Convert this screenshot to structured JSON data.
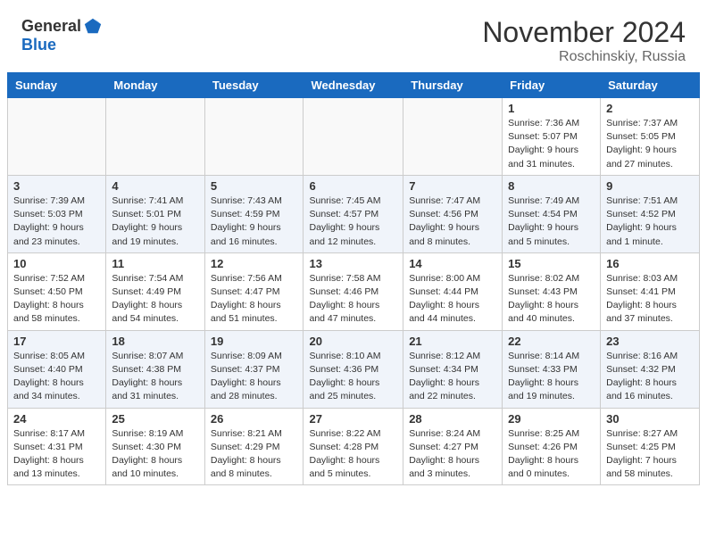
{
  "header": {
    "logo_general": "General",
    "logo_blue": "Blue",
    "month_title": "November 2024",
    "location": "Roschinskiy, Russia"
  },
  "days_of_week": [
    "Sunday",
    "Monday",
    "Tuesday",
    "Wednesday",
    "Thursday",
    "Friday",
    "Saturday"
  ],
  "weeks": [
    [
      {
        "day": "",
        "info": ""
      },
      {
        "day": "",
        "info": ""
      },
      {
        "day": "",
        "info": ""
      },
      {
        "day": "",
        "info": ""
      },
      {
        "day": "",
        "info": ""
      },
      {
        "day": "1",
        "info": "Sunrise: 7:36 AM\nSunset: 5:07 PM\nDaylight: 9 hours and 31 minutes."
      },
      {
        "day": "2",
        "info": "Sunrise: 7:37 AM\nSunset: 5:05 PM\nDaylight: 9 hours and 27 minutes."
      }
    ],
    [
      {
        "day": "3",
        "info": "Sunrise: 7:39 AM\nSunset: 5:03 PM\nDaylight: 9 hours and 23 minutes."
      },
      {
        "day": "4",
        "info": "Sunrise: 7:41 AM\nSunset: 5:01 PM\nDaylight: 9 hours and 19 minutes."
      },
      {
        "day": "5",
        "info": "Sunrise: 7:43 AM\nSunset: 4:59 PM\nDaylight: 9 hours and 16 minutes."
      },
      {
        "day": "6",
        "info": "Sunrise: 7:45 AM\nSunset: 4:57 PM\nDaylight: 9 hours and 12 minutes."
      },
      {
        "day": "7",
        "info": "Sunrise: 7:47 AM\nSunset: 4:56 PM\nDaylight: 9 hours and 8 minutes."
      },
      {
        "day": "8",
        "info": "Sunrise: 7:49 AM\nSunset: 4:54 PM\nDaylight: 9 hours and 5 minutes."
      },
      {
        "day": "9",
        "info": "Sunrise: 7:51 AM\nSunset: 4:52 PM\nDaylight: 9 hours and 1 minute."
      }
    ],
    [
      {
        "day": "10",
        "info": "Sunrise: 7:52 AM\nSunset: 4:50 PM\nDaylight: 8 hours and 58 minutes."
      },
      {
        "day": "11",
        "info": "Sunrise: 7:54 AM\nSunset: 4:49 PM\nDaylight: 8 hours and 54 minutes."
      },
      {
        "day": "12",
        "info": "Sunrise: 7:56 AM\nSunset: 4:47 PM\nDaylight: 8 hours and 51 minutes."
      },
      {
        "day": "13",
        "info": "Sunrise: 7:58 AM\nSunset: 4:46 PM\nDaylight: 8 hours and 47 minutes."
      },
      {
        "day": "14",
        "info": "Sunrise: 8:00 AM\nSunset: 4:44 PM\nDaylight: 8 hours and 44 minutes."
      },
      {
        "day": "15",
        "info": "Sunrise: 8:02 AM\nSunset: 4:43 PM\nDaylight: 8 hours and 40 minutes."
      },
      {
        "day": "16",
        "info": "Sunrise: 8:03 AM\nSunset: 4:41 PM\nDaylight: 8 hours and 37 minutes."
      }
    ],
    [
      {
        "day": "17",
        "info": "Sunrise: 8:05 AM\nSunset: 4:40 PM\nDaylight: 8 hours and 34 minutes."
      },
      {
        "day": "18",
        "info": "Sunrise: 8:07 AM\nSunset: 4:38 PM\nDaylight: 8 hours and 31 minutes."
      },
      {
        "day": "19",
        "info": "Sunrise: 8:09 AM\nSunset: 4:37 PM\nDaylight: 8 hours and 28 minutes."
      },
      {
        "day": "20",
        "info": "Sunrise: 8:10 AM\nSunset: 4:36 PM\nDaylight: 8 hours and 25 minutes."
      },
      {
        "day": "21",
        "info": "Sunrise: 8:12 AM\nSunset: 4:34 PM\nDaylight: 8 hours and 22 minutes."
      },
      {
        "day": "22",
        "info": "Sunrise: 8:14 AM\nSunset: 4:33 PM\nDaylight: 8 hours and 19 minutes."
      },
      {
        "day": "23",
        "info": "Sunrise: 8:16 AM\nSunset: 4:32 PM\nDaylight: 8 hours and 16 minutes."
      }
    ],
    [
      {
        "day": "24",
        "info": "Sunrise: 8:17 AM\nSunset: 4:31 PM\nDaylight: 8 hours and 13 minutes."
      },
      {
        "day": "25",
        "info": "Sunrise: 8:19 AM\nSunset: 4:30 PM\nDaylight: 8 hours and 10 minutes."
      },
      {
        "day": "26",
        "info": "Sunrise: 8:21 AM\nSunset: 4:29 PM\nDaylight: 8 hours and 8 minutes."
      },
      {
        "day": "27",
        "info": "Sunrise: 8:22 AM\nSunset: 4:28 PM\nDaylight: 8 hours and 5 minutes."
      },
      {
        "day": "28",
        "info": "Sunrise: 8:24 AM\nSunset: 4:27 PM\nDaylight: 8 hours and 3 minutes."
      },
      {
        "day": "29",
        "info": "Sunrise: 8:25 AM\nSunset: 4:26 PM\nDaylight: 8 hours and 0 minutes."
      },
      {
        "day": "30",
        "info": "Sunrise: 8:27 AM\nSunset: 4:25 PM\nDaylight: 7 hours and 58 minutes."
      }
    ]
  ]
}
